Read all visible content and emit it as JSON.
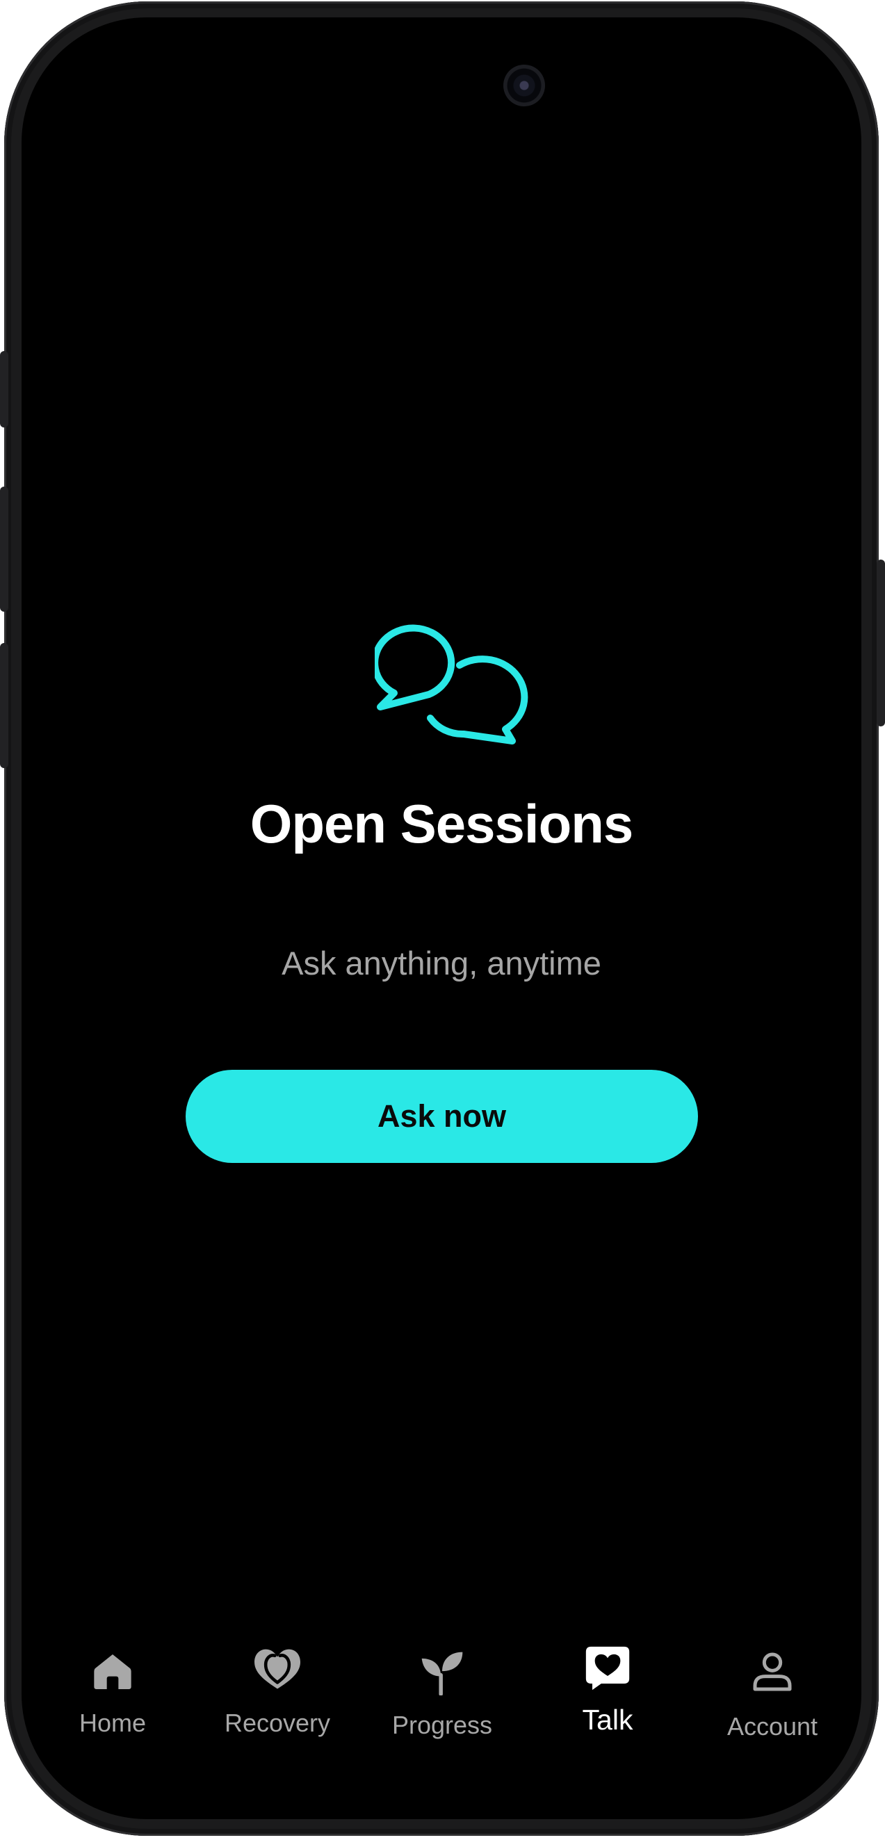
{
  "main": {
    "icon": "chat-bubbles-icon",
    "title": "Open Sessions",
    "subtitle": "Ask anything, anytime",
    "cta_label": "Ask now"
  },
  "tabbar": {
    "items": [
      {
        "label": "Home",
        "icon": "home-icon",
        "active": false
      },
      {
        "label": "Recovery",
        "icon": "hearts-icon",
        "active": false
      },
      {
        "label": "Progress",
        "icon": "sprout-icon",
        "active": false
      },
      {
        "label": "Talk",
        "icon": "heart-message-icon",
        "active": true
      },
      {
        "label": "Account",
        "icon": "person-icon",
        "active": false
      }
    ]
  },
  "colors": {
    "accent": "#2ae8e6",
    "background": "#000000",
    "text_primary": "#ffffff",
    "text_secondary": "#a6a6a6",
    "tab_inactive": "#a8a8a8"
  }
}
